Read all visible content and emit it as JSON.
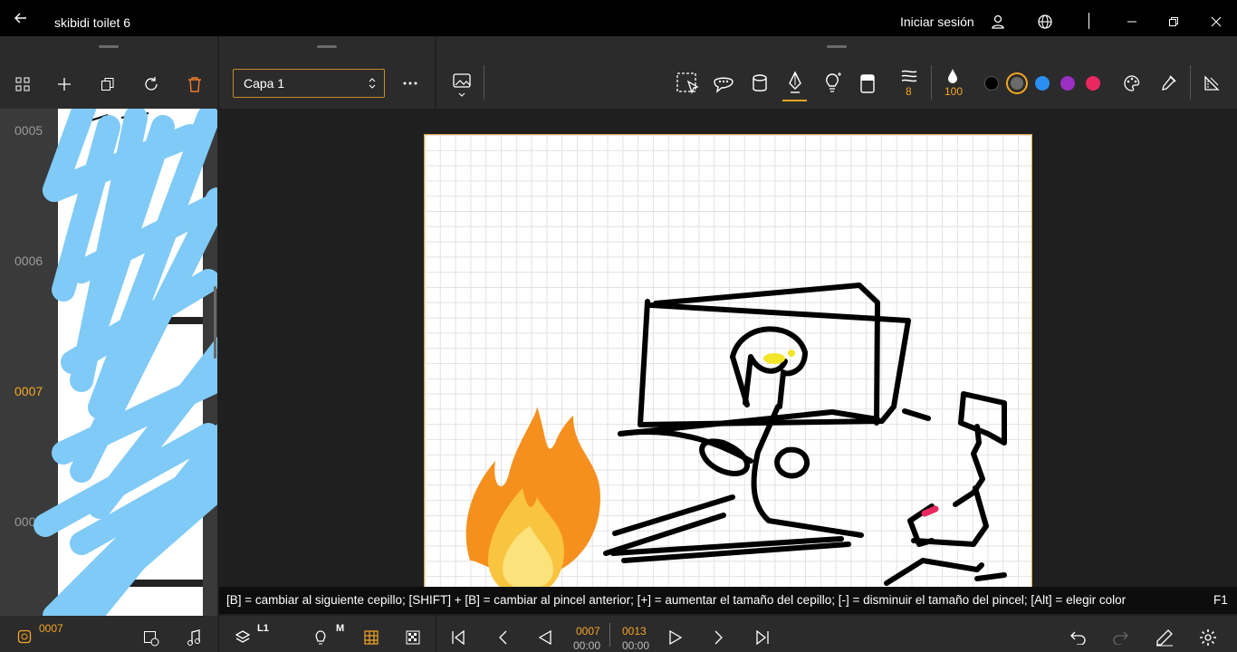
{
  "titlebar": {
    "title": "skibidi toilet 6",
    "login_label": "Iniciar sesión"
  },
  "layers": {
    "current_layer": "Capa 1"
  },
  "toolbar": {
    "brush_size": "8",
    "opacity": "100",
    "colors": [
      "#000000",
      "#6b6b6b",
      "#2a8ff0",
      "#9b2fc3",
      "#e8285f"
    ],
    "accent": "#f5a623"
  },
  "frames": [
    {
      "label": "0005"
    },
    {
      "label": "0006"
    },
    {
      "label": "0007"
    },
    {
      "label": "000"
    }
  ],
  "hint": {
    "text": "[B] = cambiar al siguiente cepillo; [SHIFT] + [B] = cambiar al pincel anterior; [+] = aumentar el tamaño del cepillo; [-] = disminuir el tamaño del pincel; [Alt] = elegir color",
    "key": "F1"
  },
  "bottom": {
    "current_frame": "0007",
    "layer_badge": "L1",
    "mode_badge": "M",
    "frame_current": "0007",
    "time_current": "00:00",
    "frame_total": "0013",
    "time_total": "00:00"
  }
}
